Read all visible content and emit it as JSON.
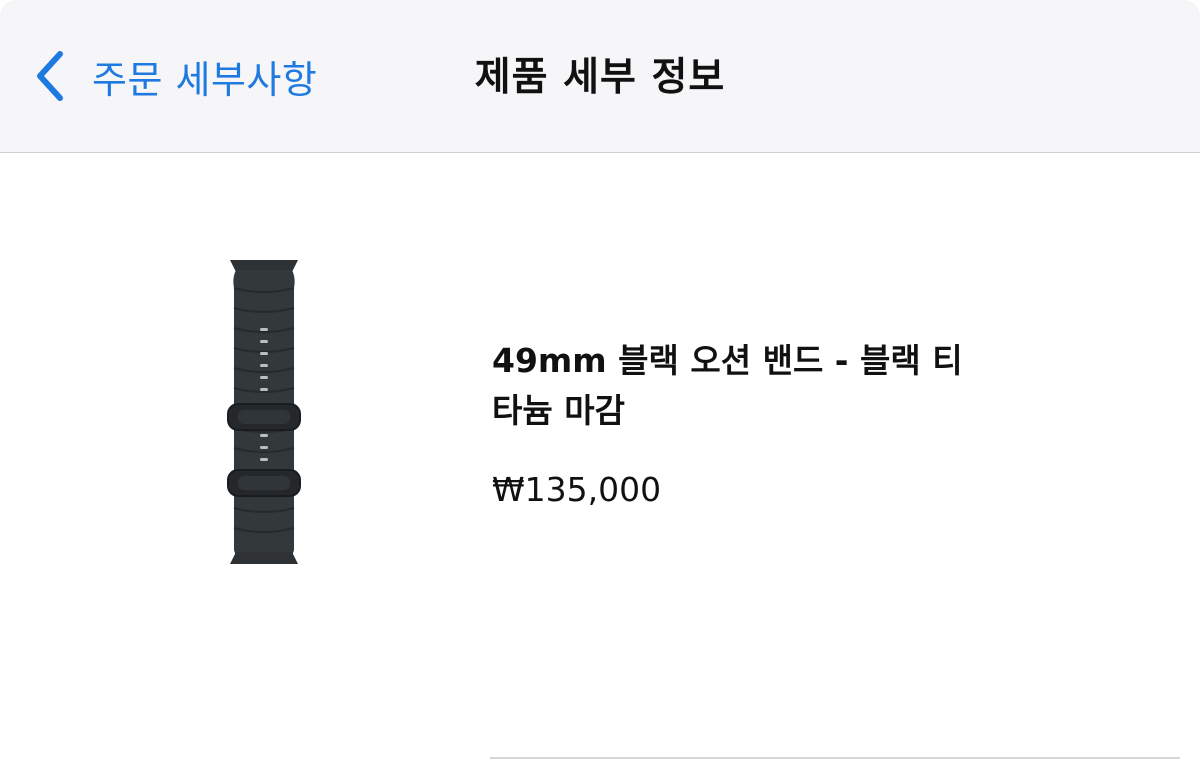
{
  "navbar": {
    "back_label": "주문 세부사항",
    "title": "제품 세부 정보"
  },
  "product": {
    "name": "49mm 블랙 오션 밴드 - 블랙 티타늄 마감",
    "price": "₩135,000",
    "image_icon": "watch-band-image"
  },
  "colors": {
    "accent": "#1e7ae0",
    "navbar_bg": "#f6f6f8",
    "text": "#111111"
  }
}
